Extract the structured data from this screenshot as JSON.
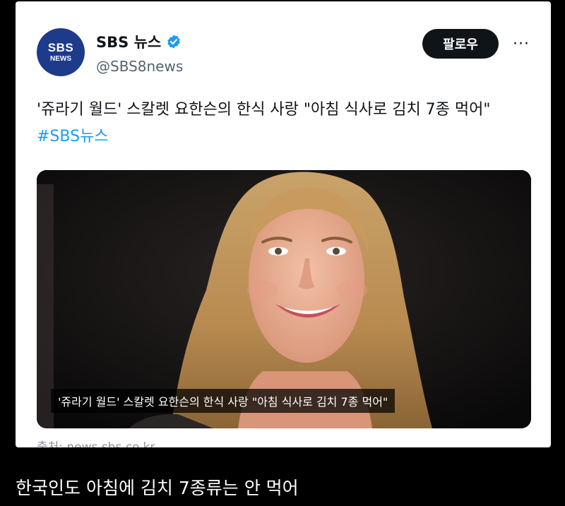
{
  "account": {
    "logo_line1": "SBS",
    "logo_line2": "NEWS",
    "name": "SBS 뉴스",
    "handle": "@SBS8news",
    "follow_label": "팔로우",
    "more_label": "···"
  },
  "tweet": {
    "text": "'쥬라기 월드' 스칼렛 요한슨의 한식 사랑 \"아침 식사로 김치 7종 먹어\"",
    "hashtag": "#SBS뉴스"
  },
  "media": {
    "caption": "'쥬라기 월드' 스칼렛 요한슨의 한식 사랑 \"아침 식사로 김치 7종 먹어\""
  },
  "source": "출처: news.sbs.co.kr",
  "footer_comment": "한국인도 아침에 김치 7종류는 안 먹어",
  "colors": {
    "background": "#000000",
    "card": "#ffffff",
    "follow_button": "#0f1419",
    "hashtag": "#1d9bf0",
    "verified": "#1d9bf0",
    "avatar": "#1e3a8a"
  }
}
